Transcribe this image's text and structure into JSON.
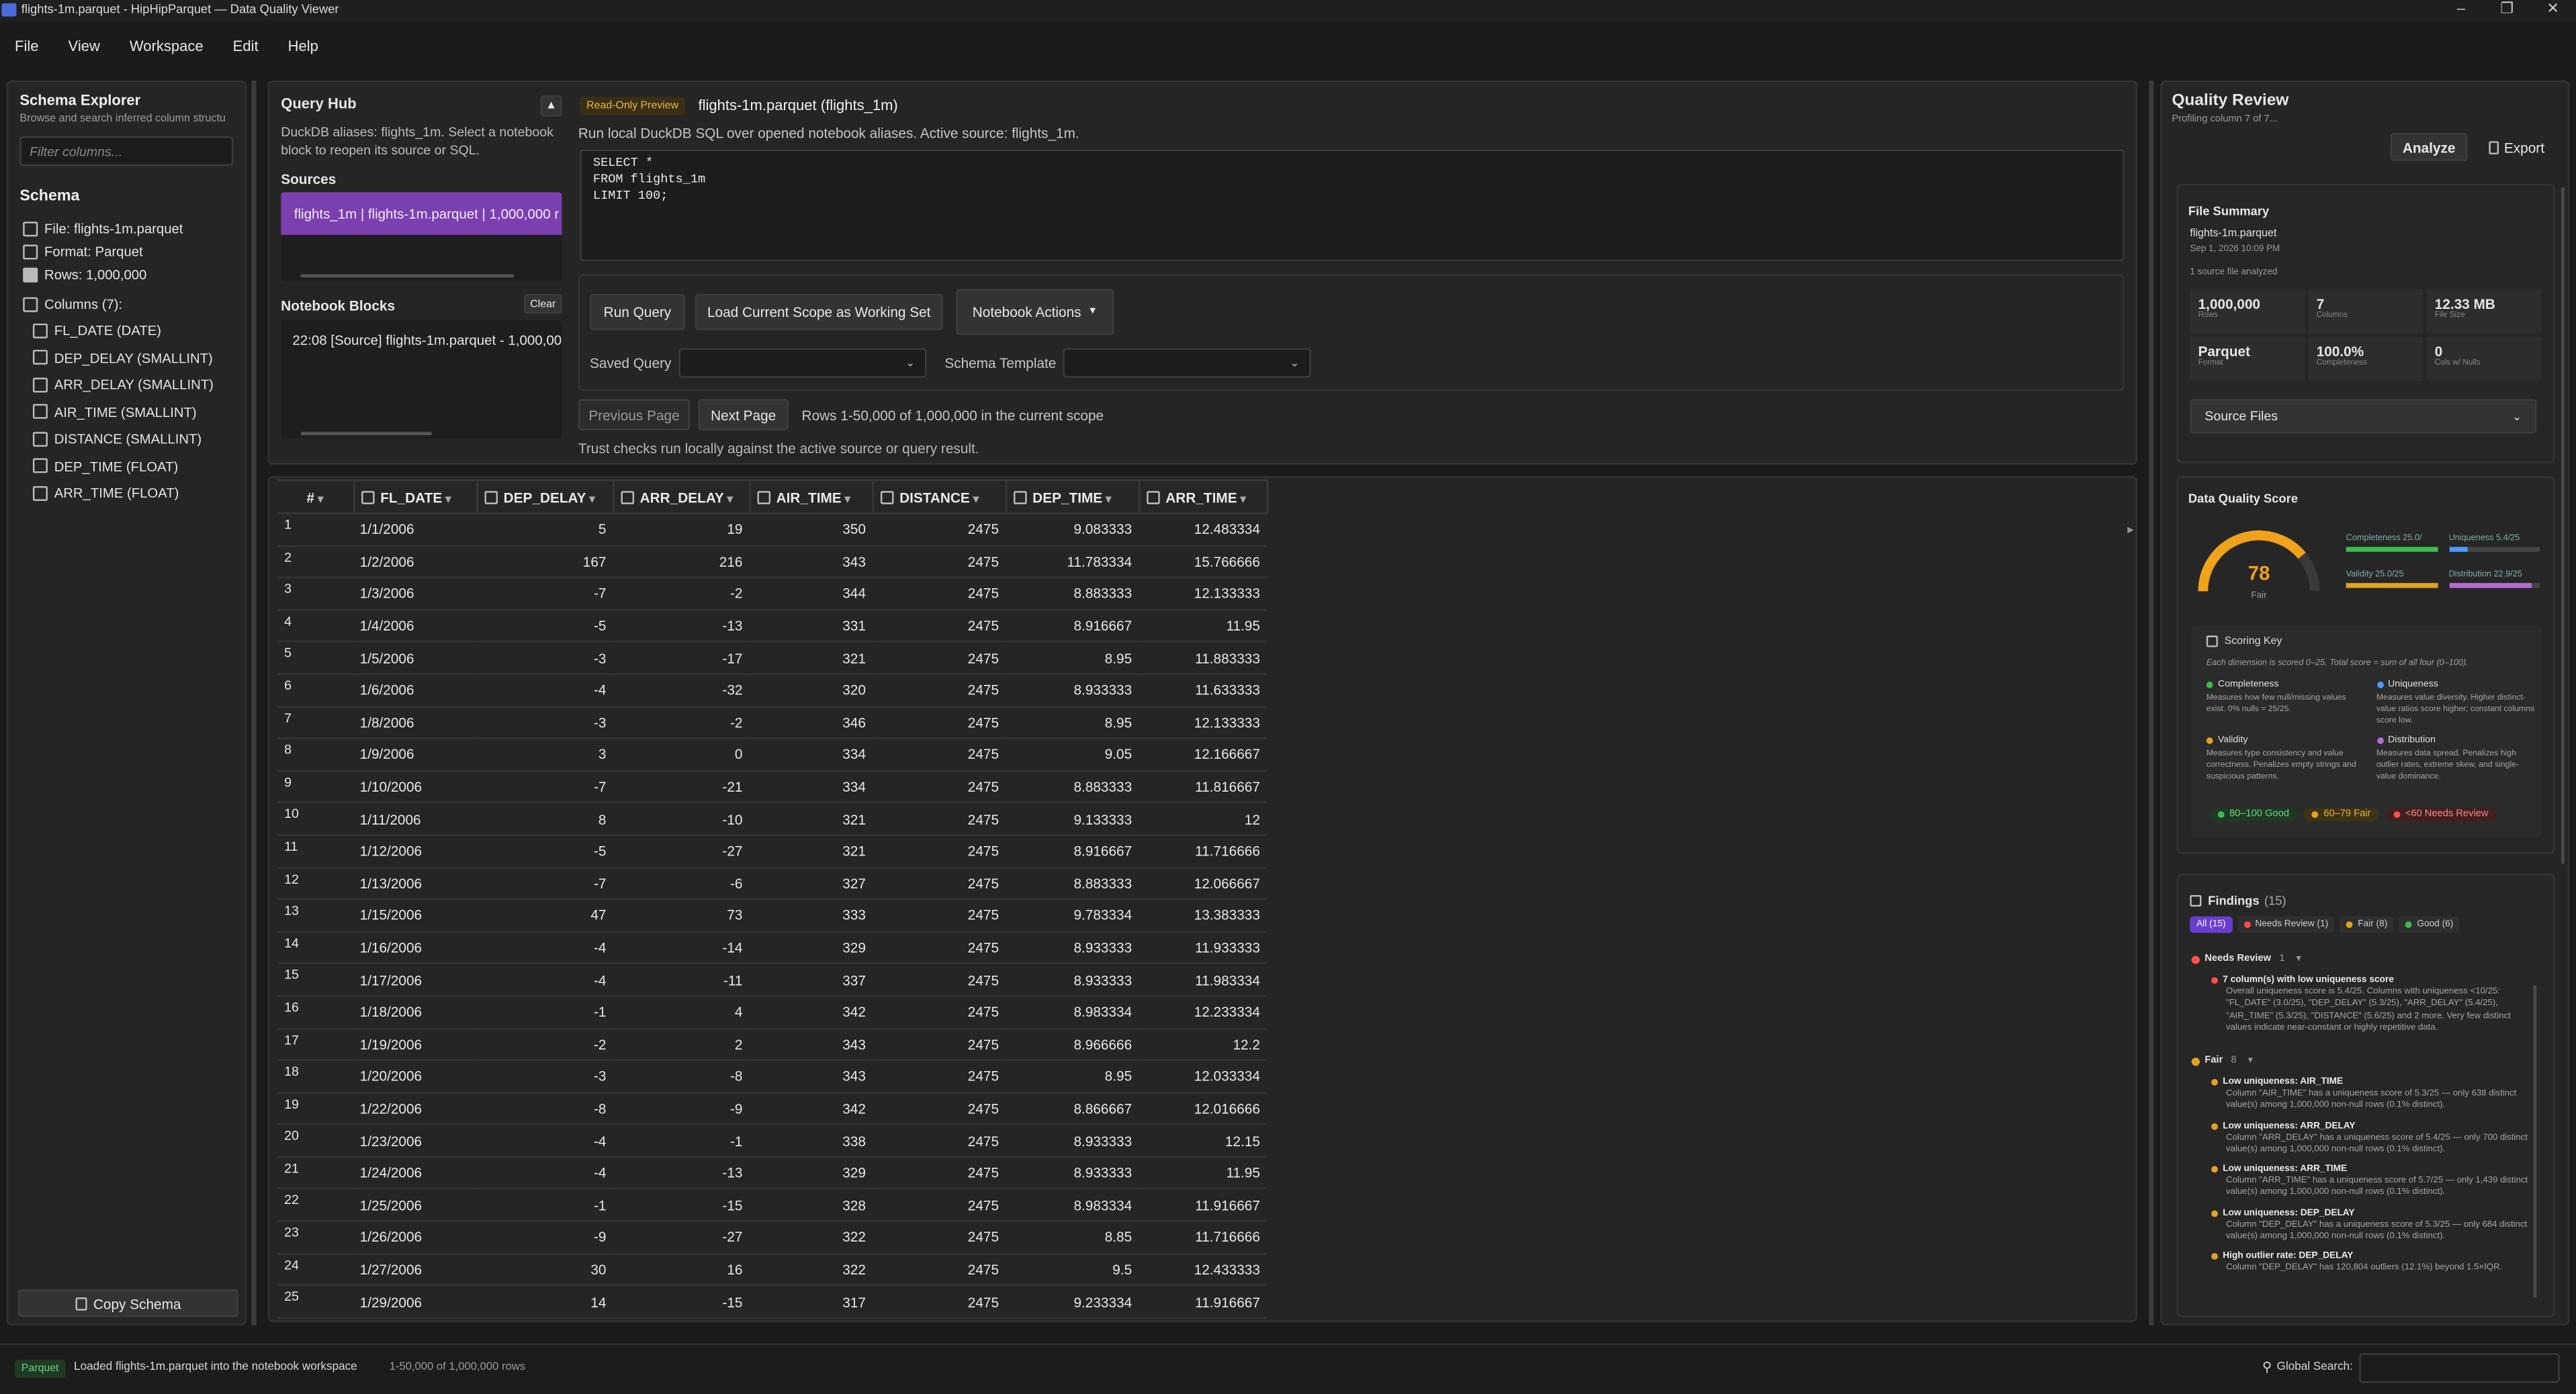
{
  "window": {
    "title": "flights-1m.parquet - HipHipParquet — Data Quality Viewer"
  },
  "menu": [
    "File",
    "View",
    "Workspace",
    "Edit",
    "Help"
  ],
  "schema_explorer": {
    "title": "Schema Explorer",
    "subtitle": "Browse and search inferred column structu",
    "filter_placeholder": "Filter columns...",
    "schema_heading": "Schema",
    "file": "File: flights-1m.parquet",
    "format": "Format: Parquet",
    "rows": "Rows: 1,000,000",
    "columns_label": "Columns (7):",
    "columns": [
      "FL_DATE (DATE)",
      "DEP_DELAY (SMALLINT)",
      "ARR_DELAY (SMALLINT)",
      "AIR_TIME (SMALLINT)",
      "DISTANCE (SMALLINT)",
      "DEP_TIME (FLOAT)",
      "ARR_TIME (FLOAT)"
    ],
    "copy_button": "Copy Schema"
  },
  "query_hub": {
    "title": "Query Hub",
    "desc": "DuckDB aliases: flights_1m. Select a notebook block to reopen its source or SQL.",
    "sources_label": "Sources",
    "source_item": "flights_1m | flights-1m.parquet | 1,000,000 r",
    "notebook_label": "Notebook Blocks",
    "clear": "Clear",
    "notebook_item": "22:08 [Source] flights-1m.parquet - 1,000,00",
    "badge": "Read-Only Preview",
    "active_file": "flights-1m.parquet (flights_1m)",
    "sql_desc": "Run local DuckDB SQL over opened notebook aliases. Active source: flights_1m.",
    "sql": "SELECT *\nFROM flights_1m\nLIMIT 100;",
    "run": "Run Query",
    "load_scope": "Load Current Scope as Working Set",
    "notebook_actions": "Notebook Actions",
    "saved_query_label": "Saved Query",
    "schema_template_label": "Schema Template",
    "prev": "Previous Page",
    "next": "Next Page",
    "rows_info": "Rows 1-50,000 of 1,000,000 in the current scope",
    "trust": "Trust checks run locally against the active source or query result."
  },
  "grid": {
    "columns": [
      "#",
      "FL_DATE",
      "DEP_DELAY",
      "ARR_DELAY",
      "AIR_TIME",
      "DISTANCE",
      "DEP_TIME",
      "ARR_TIME"
    ],
    "rows": [
      [
        "1",
        "1/1/2006",
        "5",
        "19",
        "350",
        "2475",
        "9.083333",
        "12.483334"
      ],
      [
        "2",
        "1/2/2006",
        "167",
        "216",
        "343",
        "2475",
        "11.783334",
        "15.766666"
      ],
      [
        "3",
        "1/3/2006",
        "-7",
        "-2",
        "344",
        "2475",
        "8.883333",
        "12.133333"
      ],
      [
        "4",
        "1/4/2006",
        "-5",
        "-13",
        "331",
        "2475",
        "8.916667",
        "11.95"
      ],
      [
        "5",
        "1/5/2006",
        "-3",
        "-17",
        "321",
        "2475",
        "8.95",
        "11.883333"
      ],
      [
        "6",
        "1/6/2006",
        "-4",
        "-32",
        "320",
        "2475",
        "8.933333",
        "11.633333"
      ],
      [
        "7",
        "1/8/2006",
        "-3",
        "-2",
        "346",
        "2475",
        "8.95",
        "12.133333"
      ],
      [
        "8",
        "1/9/2006",
        "3",
        "0",
        "334",
        "2475",
        "9.05",
        "12.166667"
      ],
      [
        "9",
        "1/10/2006",
        "-7",
        "-21",
        "334",
        "2475",
        "8.883333",
        "11.816667"
      ],
      [
        "10",
        "1/11/2006",
        "8",
        "-10",
        "321",
        "2475",
        "9.133333",
        "12"
      ],
      [
        "11",
        "1/12/2006",
        "-5",
        "-27",
        "321",
        "2475",
        "8.916667",
        "11.716666"
      ],
      [
        "12",
        "1/13/2006",
        "-7",
        "-6",
        "327",
        "2475",
        "8.883333",
        "12.066667"
      ],
      [
        "13",
        "1/15/2006",
        "47",
        "73",
        "333",
        "2475",
        "9.783334",
        "13.383333"
      ],
      [
        "14",
        "1/16/2006",
        "-4",
        "-14",
        "329",
        "2475",
        "8.933333",
        "11.933333"
      ],
      [
        "15",
        "1/17/2006",
        "-4",
        "-11",
        "337",
        "2475",
        "8.933333",
        "11.983334"
      ],
      [
        "16",
        "1/18/2006",
        "-1",
        "4",
        "342",
        "2475",
        "8.983334",
        "12.233334"
      ],
      [
        "17",
        "1/19/2006",
        "-2",
        "2",
        "343",
        "2475",
        "8.966666",
        "12.2"
      ],
      [
        "18",
        "1/20/2006",
        "-3",
        "-8",
        "343",
        "2475",
        "8.95",
        "12.033334"
      ],
      [
        "19",
        "1/22/2006",
        "-8",
        "-9",
        "342",
        "2475",
        "8.866667",
        "12.016666"
      ],
      [
        "20",
        "1/23/2006",
        "-4",
        "-1",
        "338",
        "2475",
        "8.933333",
        "12.15"
      ],
      [
        "21",
        "1/24/2006",
        "-4",
        "-13",
        "329",
        "2475",
        "8.933333",
        "11.95"
      ],
      [
        "22",
        "1/25/2006",
        "-1",
        "-15",
        "328",
        "2475",
        "8.983334",
        "11.916667"
      ],
      [
        "23",
        "1/26/2006",
        "-9",
        "-27",
        "322",
        "2475",
        "8.85",
        "11.716666"
      ],
      [
        "24",
        "1/27/2006",
        "30",
        "16",
        "322",
        "2475",
        "9.5",
        "12.433333"
      ],
      [
        "25",
        "1/29/2006",
        "14",
        "-15",
        "317",
        "2475",
        "9.233334",
        "11.916667"
      ]
    ]
  },
  "quality": {
    "title": "Quality Review",
    "subtitle": "Profiling column 7 of 7...",
    "analyze": "Analyze",
    "export": "Export",
    "summary": {
      "title": "File Summary",
      "file": "flights-1m.parquet",
      "date": "Sep 1, 2026 10:09 PM",
      "analyzed": "1 source file analyzed",
      "stats": [
        {
          "v": "1,000,000",
          "l": "Rows"
        },
        {
          "v": "7",
          "l": "Columns"
        },
        {
          "v": "12.33 MB",
          "l": "File Size"
        },
        {
          "v": "Parquet",
          "l": "Format"
        },
        {
          "v": "100.0%",
          "l": "Completeness"
        },
        {
          "v": "0",
          "l": "Cols w/ Nulls"
        }
      ],
      "source_files": "Source Files"
    },
    "score": {
      "title": "Data Quality Score",
      "value": 78,
      "label": "Fair",
      "dims": [
        {
          "name": "Completeness 25.0/",
          "value": 1.0,
          "color": "#3fb950"
        },
        {
          "name": "Uniqueness 5.4/25",
          "value": 0.216,
          "color": "#4a9eff"
        },
        {
          "name": "Validity 25.0/25",
          "value": 1.0,
          "color": "#e3a420"
        },
        {
          "name": "Distribution 22.9/25",
          "value": 0.916,
          "color": "#b56cd6"
        }
      ],
      "key_title": "Scoring Key",
      "key_desc": "Each dimension is scored 0–25. Total score = sum of all four (0–100).",
      "keys": [
        {
          "name": "Completeness",
          "color": "#3fb950",
          "desc": "Measures how few null/missing values exist. 0% nulls = 25/25."
        },
        {
          "name": "Uniqueness",
          "color": "#4a9eff",
          "desc": "Measures value diversity. Higher distinct-value ratios score higher; constant columns score low."
        },
        {
          "name": "Validity",
          "color": "#e3a420",
          "desc": "Measures type consistency and value correctness. Penalizes empty strings and suspicious patterns."
        },
        {
          "name": "Distribution",
          "color": "#b56cd6",
          "desc": "Measures data spread. Penalizes high outlier rates, extreme skew, and single-value dominance."
        }
      ],
      "legend": [
        "80–100 Good",
        "60–79 Fair",
        "<60 Needs Review"
      ]
    },
    "findings": {
      "title": "Findings",
      "count": "(15)",
      "filters": [
        "All (15)",
        "Needs Review (1)",
        "Fair (8)",
        "Good (6)"
      ],
      "needs_review": {
        "label": "Needs Review",
        "count": "1",
        "items": [
          {
            "title": "7 column(s) with low uniqueness score",
            "desc": "Overall uniqueness score is 5.4/25. Columns with uniqueness <10/25: \"FL_DATE\" (3.0/25), \"DEP_DELAY\" (5.3/25), \"ARR_DELAY\" (5.4/25), \"AIR_TIME\" (5.3/25), \"DISTANCE\" (5.6/25) and 2 more. Very few distinct values indicate near-constant or highly repetitive data."
          }
        ]
      },
      "fair": {
        "label": "Fair",
        "count": "8",
        "items": [
          {
            "title": "Low uniqueness: AIR_TIME",
            "desc": "Column \"AIR_TIME\" has a uniqueness score of 5.3/25 — only 638 distinct value(s) among 1,000,000 non-null rows (0.1% distinct)."
          },
          {
            "title": "Low uniqueness: ARR_DELAY",
            "desc": "Column \"ARR_DELAY\" has a uniqueness score of 5.4/25 — only 700 distinct value(s) among 1,000,000 non-null rows (0.1% distinct)."
          },
          {
            "title": "Low uniqueness: ARR_TIME",
            "desc": "Column \"ARR_TIME\" has a uniqueness score of 5.7/25 — only 1,439 distinct value(s) among 1,000,000 non-null rows (0.1% distinct)."
          },
          {
            "title": "Low uniqueness: DEP_DELAY",
            "desc": "Column \"DEP_DELAY\" has a uniqueness score of 5.3/25 — only 684 distinct value(s) among 1,000,000 non-null rows (0.1% distinct)."
          },
          {
            "title": "High outlier rate: DEP_DELAY",
            "desc": "Column \"DEP_DELAY\" has 120,804 outliers (12.1%) beyond 1.5×IQR."
          }
        ]
      }
    }
  },
  "status": {
    "badge": "Parquet",
    "message": "Loaded flights-1m.parquet into the notebook workspace",
    "rows": "1-50,000 of 1,000,000 rows",
    "search_label": "Global Search:"
  },
  "colors": {
    "accent": "#7b3fb0",
    "purple_btn": "#6a3dd1"
  }
}
